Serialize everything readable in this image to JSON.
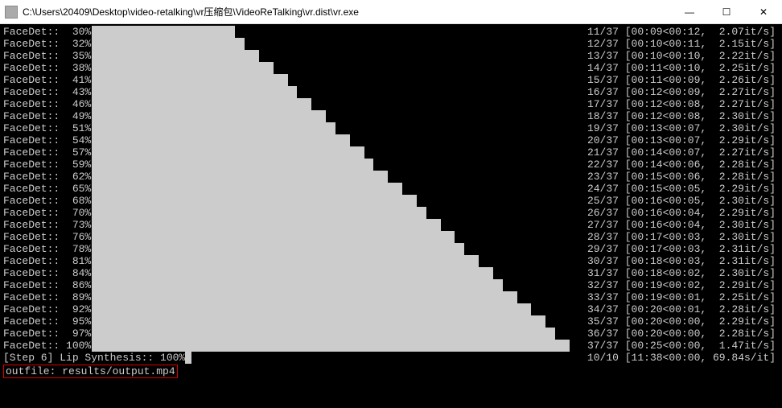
{
  "window": {
    "title": "C:\\Users\\20409\\Desktop\\video-retalking\\vr压缩包\\VideoReTalking\\vr.dist\\vr.exe",
    "minimize": "—",
    "maximize": "☐",
    "close": "✕"
  },
  "faceDetRows": [
    {
      "pct": "30%",
      "n": "11/37",
      "t": "[00:09<00:12,",
      "r": "2.07it/s]"
    },
    {
      "pct": "32%",
      "n": "12/37",
      "t": "[00:10<00:11,",
      "r": "2.15it/s]"
    },
    {
      "pct": "35%",
      "n": "13/37",
      "t": "[00:10<00:10,",
      "r": "2.22it/s]"
    },
    {
      "pct": "38%",
      "n": "14/37",
      "t": "[00:11<00:10,",
      "r": "2.25it/s]"
    },
    {
      "pct": "41%",
      "n": "15/37",
      "t": "[00:11<00:09,",
      "r": "2.26it/s]"
    },
    {
      "pct": "43%",
      "n": "16/37",
      "t": "[00:12<00:09,",
      "r": "2.27it/s]"
    },
    {
      "pct": "46%",
      "n": "17/37",
      "t": "[00:12<00:08,",
      "r": "2.27it/s]"
    },
    {
      "pct": "49%",
      "n": "18/37",
      "t": "[00:12<00:08,",
      "r": "2.30it/s]"
    },
    {
      "pct": "51%",
      "n": "19/37",
      "t": "[00:13<00:07,",
      "r": "2.30it/s]"
    },
    {
      "pct": "54%",
      "n": "20/37",
      "t": "[00:13<00:07,",
      "r": "2.29it/s]"
    },
    {
      "pct": "57%",
      "n": "21/37",
      "t": "[00:14<00:07,",
      "r": "2.27it/s]"
    },
    {
      "pct": "59%",
      "n": "22/37",
      "t": "[00:14<00:06,",
      "r": "2.28it/s]"
    },
    {
      "pct": "62%",
      "n": "23/37",
      "t": "[00:15<00:06,",
      "r": "2.28it/s]"
    },
    {
      "pct": "65%",
      "n": "24/37",
      "t": "[00:15<00:05,",
      "r": "2.29it/s]"
    },
    {
      "pct": "68%",
      "n": "25/37",
      "t": "[00:16<00:05,",
      "r": "2.30it/s]"
    },
    {
      "pct": "70%",
      "n": "26/37",
      "t": "[00:16<00:04,",
      "r": "2.29it/s]"
    },
    {
      "pct": "73%",
      "n": "27/37",
      "t": "[00:16<00:04,",
      "r": "2.30it/s]"
    },
    {
      "pct": "76%",
      "n": "28/37",
      "t": "[00:17<00:03,",
      "r": "2.30it/s]"
    },
    {
      "pct": "78%",
      "n": "29/37",
      "t": "[00:17<00:03,",
      "r": "2.31it/s]"
    },
    {
      "pct": "81%",
      "n": "30/37",
      "t": "[00:18<00:03,",
      "r": "2.31it/s]"
    },
    {
      "pct": "84%",
      "n": "31/37",
      "t": "[00:18<00:02,",
      "r": "2.30it/s]"
    },
    {
      "pct": "86%",
      "n": "32/37",
      "t": "[00:19<00:02,",
      "r": "2.29it/s]"
    },
    {
      "pct": "89%",
      "n": "33/37",
      "t": "[00:19<00:01,",
      "r": "2.25it/s]"
    },
    {
      "pct": "92%",
      "n": "34/37",
      "t": "[00:20<00:01,",
      "r": "2.28it/s]"
    },
    {
      "pct": "95%",
      "n": "35/37",
      "t": "[00:20<00:00,",
      "r": "2.29it/s]"
    },
    {
      "pct": "97%",
      "n": "36/37",
      "t": "[00:20<00:00,",
      "r": "2.28it/s]"
    },
    {
      "pct": "100%",
      "n": "37/37",
      "t": "[00:25<00:00,",
      "r": "1.47it/s]"
    }
  ],
  "labelPrefix": "FaceDet::",
  "step6": {
    "label": "[Step 6] Lip Synthesis:: 100%",
    "n": "10/10",
    "t": "[11:38<00:00,",
    "r": "69.84s/it]"
  },
  "outfile": "outfile: results/output.mp4"
}
